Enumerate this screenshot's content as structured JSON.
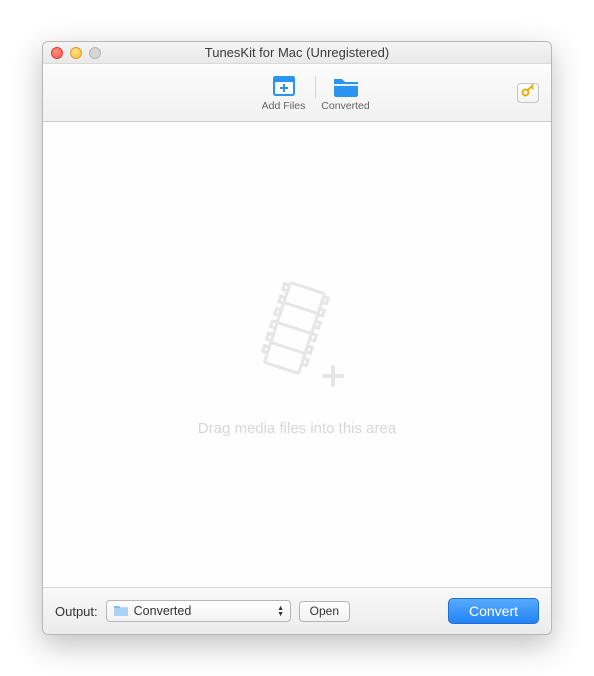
{
  "window": {
    "title": "TunesKit for Mac (Unregistered)"
  },
  "toolbar": {
    "add_files_label": "Add Files",
    "converted_label": "Converted"
  },
  "content": {
    "drop_hint": "Drag media files into this area"
  },
  "bottom": {
    "output_label": "Output:",
    "dropdown_value": "Converted",
    "open_label": "Open",
    "convert_label": "Convert"
  }
}
